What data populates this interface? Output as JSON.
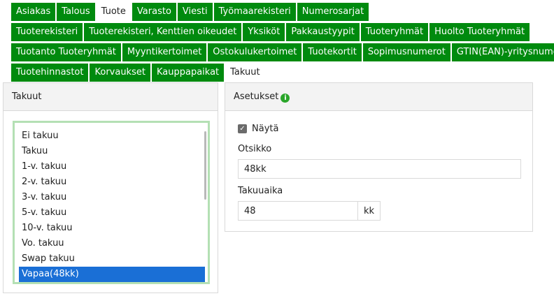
{
  "tabs": {
    "row1": [
      "Asiakas",
      "Talous",
      "Tuote",
      "Varasto",
      "Viesti",
      "Työmaarekisteri",
      "Numerosarjat"
    ],
    "row1_active": "Tuote",
    "row2": [
      "Tuoterekisteri",
      "Tuoterekisteri, Kenttien oikeudet",
      "Yksiköt",
      "Pakkaustyypit",
      "Tuoteryhmät",
      "Huolto Tuoteryhmät"
    ],
    "row3": [
      "Tuotanto Tuoteryhmät",
      "Myyntikertoimet",
      "Ostokulukertoimet",
      "Tuotekortit",
      "Sopimusnumerot",
      "GTIN(EAN)-yritysnumerot"
    ],
    "row4": [
      "Tuotehinnastot",
      "Korvaukset",
      "Kauppapaikat",
      "Takuut"
    ],
    "row4_active": "Takuut"
  },
  "left_panel": {
    "title": "Takuut",
    "items": [
      "Ei takuu",
      "Takuu",
      "1-v. takuu",
      "2-v. takuu",
      "3-v. takuu",
      "5-v. takuu",
      "10-v. takuu",
      "Vo. takuu",
      "Swap takuu",
      "Vapaa(48kk)"
    ],
    "selected": "Vapaa(48kk)"
  },
  "right_panel": {
    "title": "Asetukset",
    "info_icon": "info-icon",
    "show_label": "Näytä",
    "show_checked": true,
    "title_label": "Otsikko",
    "title_value": "48kk",
    "period_label": "Takuuaika",
    "period_value": "48",
    "period_unit": "kk"
  },
  "colors": {
    "tab_green": "#008a0e",
    "selected_blue": "#1a6fd6",
    "focus_green": "#b4e0b4"
  }
}
